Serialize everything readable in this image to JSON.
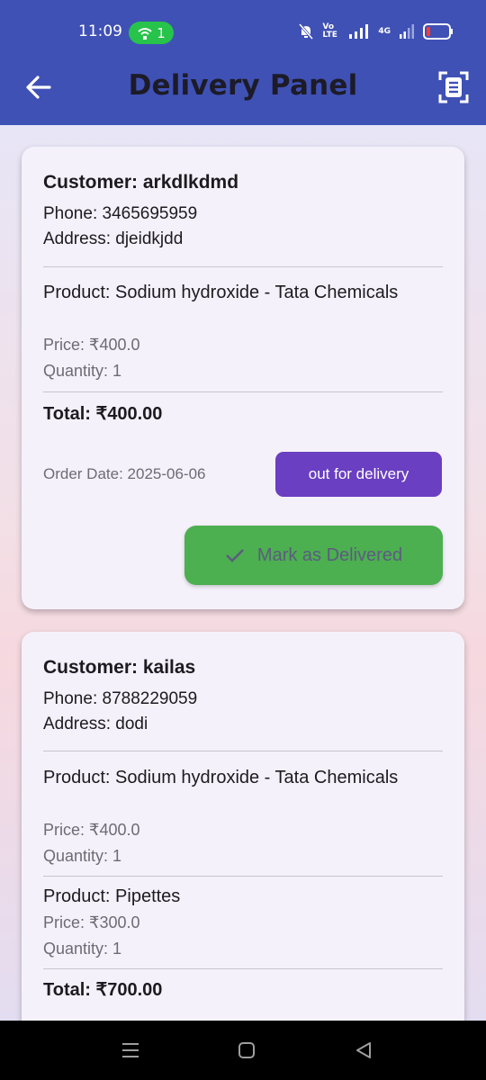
{
  "status_bar": {
    "time": "11:09",
    "hotspot_count": "1",
    "volte_label": "Vo LTE",
    "network_label": "4G"
  },
  "app_bar": {
    "title": "Delivery Panel"
  },
  "orders": [
    {
      "customer": "Customer: arkdlkdmd",
      "phone": "Phone: 3465695959",
      "address": "Address: djeidkjdd",
      "products": [
        {
          "name": "Product: Sodium hydroxide - Tata Chemicals",
          "price": "Price: ₹400.0",
          "quantity": "Quantity: 1"
        }
      ],
      "total": "Total: ₹400.00",
      "order_date": "Order Date: 2025-06-06",
      "status": "out for delivery",
      "action_label": "Mark as Delivered"
    },
    {
      "customer": "Customer: kailas",
      "phone": "Phone: 8788229059",
      "address": "Address: dodi",
      "products": [
        {
          "name": "Product: Sodium hydroxide - Tata Chemicals",
          "price": "Price: ₹400.0",
          "quantity": "Quantity: 1"
        },
        {
          "name": "Product: Pipettes",
          "price": "Price: ₹300.0",
          "quantity": "Quantity: 1"
        }
      ],
      "total": "Total: ₹700.00"
    }
  ],
  "colors": {
    "app_bar": "#3f51b5",
    "status_chip": "#6a3fc1",
    "action_button": "#4caf50",
    "hotspot": "#27c34a"
  },
  "icons": [
    "back-arrow-icon",
    "scan-document-icon",
    "check-icon",
    "wifi-hotspot-icon",
    "bell-off-icon",
    "battery-icon",
    "menu-nav-icon",
    "home-nav-icon",
    "back-nav-icon"
  ]
}
